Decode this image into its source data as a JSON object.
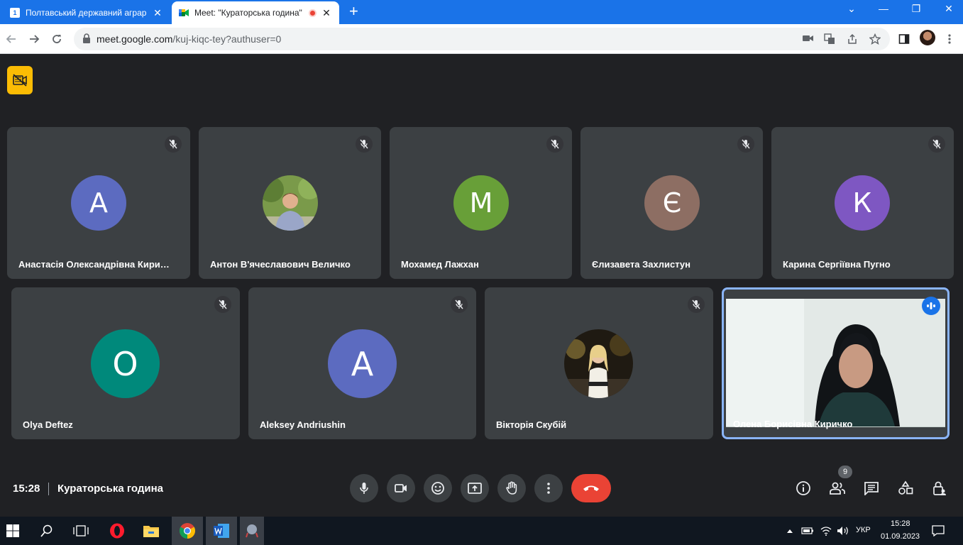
{
  "browser": {
    "tabs": [
      {
        "title": "Полтавський державний аграр",
        "favicon_text": "1",
        "active": false
      },
      {
        "title": "Meet: \"Кураторська година\"",
        "active": true
      }
    ],
    "url_host": "meet.google.com",
    "url_path": "/kuj-kiqc-tey?authuser=0",
    "window_controls": [
      "chevron-down",
      "minimize",
      "restore",
      "close"
    ]
  },
  "participants_row1": [
    {
      "name": "Анастасія Олександрівна Кири…",
      "initial": "А",
      "color": "#5c6bc0",
      "muted": true
    },
    {
      "name": "Антон В'ячеславович Величко",
      "photo": true,
      "muted": true
    },
    {
      "name": "Мохамед Лажхан",
      "initial": "М",
      "color": "#689f38",
      "muted": true
    },
    {
      "name": "Єлизавета Захлистун",
      "initial": "Є",
      "color": "#8d6e63",
      "muted": true
    },
    {
      "name": "Карина Сергіївна Пугно",
      "initial": "К",
      "color": "#7e57c2",
      "muted": true
    }
  ],
  "participants_row2": [
    {
      "name": "Olya Deftez",
      "initial": "O",
      "color": "#00897b",
      "muted": true
    },
    {
      "name": "Aleksey Andriushin",
      "initial": "A",
      "color": "#5c6bc0",
      "muted": true
    },
    {
      "name": "Вікторія Скубій",
      "photo": true,
      "muted": true
    },
    {
      "name": "Олена Борисівна Киричко",
      "video": true,
      "speaking": true
    }
  ],
  "meeting": {
    "time": "15:28",
    "title": "Кураторська година",
    "participant_count": "9"
  },
  "taskbar": {
    "lang": "УКР",
    "clock_time": "15:28",
    "clock_date": "01.09.2023"
  }
}
